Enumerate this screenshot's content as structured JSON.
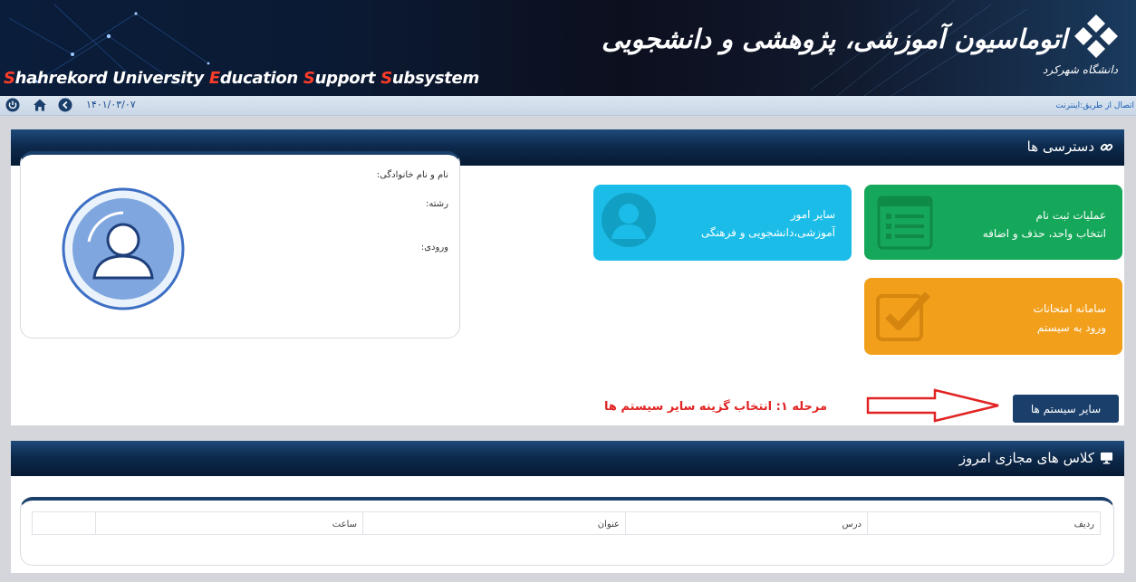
{
  "header": {
    "system_title_parts": [
      {
        "text": "S",
        "hl": true
      },
      {
        "text": "hahrekord University ",
        "hl": false
      },
      {
        "text": "E",
        "hl": true
      },
      {
        "text": "ducation ",
        "hl": false
      },
      {
        "text": "S",
        "hl": true
      },
      {
        "text": "upport ",
        "hl": false
      },
      {
        "text": "S",
        "hl": true
      },
      {
        "text": "ubsystem",
        "hl": false
      }
    ],
    "persian_title": "اتوماسیون آموزشی، پژوهشی و دانشجویی",
    "logo_subtitle": "دانشگاه شهرکرد"
  },
  "toolbar": {
    "date": "۱۴۰۱/۰۳/۰۷",
    "connection": "اتصال از طریق:اینترنت"
  },
  "access_panel": {
    "title": "دسترسی ها",
    "tiles": {
      "registration": {
        "title": "عملیات ثبت نام",
        "subtitle": "انتخاب واحد، حذف و اضافه",
        "color": "#16a85a"
      },
      "other_affairs": {
        "title": "سایر امور",
        "subtitle": "آموزشی،دانشجویی و فرهنگی",
        "color": "#1bbde8"
      },
      "exams": {
        "title": "سامانه امتحانات",
        "subtitle": "ورود به سیستم",
        "color": "#f2a01c"
      }
    },
    "profile": {
      "name_label": "نام و نام خانوادگی:",
      "major_label": "رشته:",
      "entry_label": "ورودی:"
    },
    "other_systems_button": "سایر سیستم ها",
    "step_note": "مرحله ۱: انتخاب گزینه سایر سیستم ها"
  },
  "classes_panel": {
    "title": "کلاس های مجازی امروز",
    "columns": [
      "ردیف",
      "درس",
      "عنوان",
      "ساعت",
      ""
    ]
  }
}
